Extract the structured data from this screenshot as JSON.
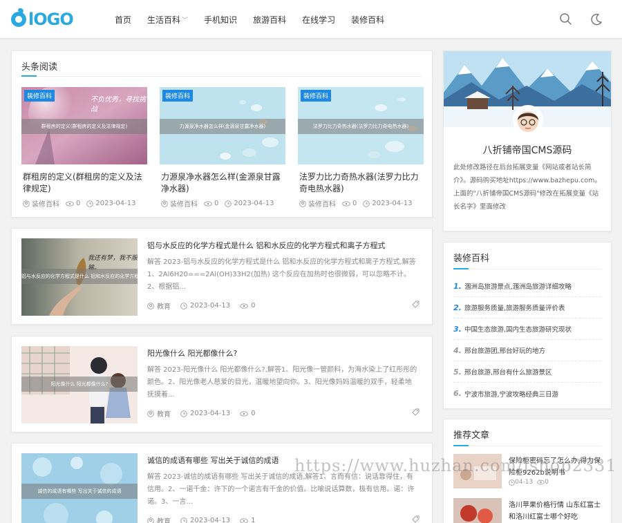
{
  "header": {
    "logo_text": "lOGO",
    "nav": [
      {
        "label": "首页"
      },
      {
        "label": "生活百科",
        "has_dropdown": true
      },
      {
        "label": "手机知识"
      },
      {
        "label": "旅游百科"
      },
      {
        "label": "在线学习"
      },
      {
        "label": "装修百科"
      }
    ]
  },
  "headline": {
    "title": "头条阅读",
    "items": [
      {
        "badge": "装修百科",
        "overlay": "群租房的定义(群租房的定义及法律规定)",
        "thumb_text": "不负优秀，寻找挑战",
        "title": "群租房的定义(群租房的定义及法律规定)",
        "author": "装修百科",
        "views": "0",
        "date": "2023-04-13"
      },
      {
        "badge": "装修百科",
        "overlay": "力源泉净水器怎么样(金源泉甘露净水器)",
        "title": "力源泉净水器怎么样(金源泉甘露净水器)",
        "author": "装修百科",
        "views": "0",
        "date": "2023-04-13"
      },
      {
        "badge": "装修百科",
        "overlay": "法罗力比力奇热水器(法罗力比力奇电热水器)",
        "title": "法罗力比力奇热水器(法罗力比力奇电热水器)",
        "author": "装修百科",
        "views": "0",
        "date": "2023-04-13"
      }
    ]
  },
  "articles": [
    {
      "overlay": "铝与水反应的化学方程式是什么 铝和水反应的化学方程式和离子",
      "thumb_text": "我还有梦，我不服输。",
      "title": "铝与水反应的化学方程式是什么 铝和水反应的化学方程式和离子方程式",
      "desc": "解答 2023-铝与水反应的化学方程式是什么 铝和水反应的化学方程式和离子方程式,解答1、2Al6H20===2Al(OH)33H2(加热) 这个反应在加热时也很微弱，可以忽略不计。2、根据铝...",
      "author": "教育",
      "date": "2023-04-13",
      "views": "0"
    },
    {
      "overlay": "阳光像什么 阳光都像什么?",
      "title": "阳光像什么 阳光都像什么?",
      "desc": "解答 2023-阳光像什么 阳光都像什么?,解答1、阳光像一管颜料，为海水染上了红彤彤的颜色。2、阳光像老人慈爱的目光，温暖地望向你。3、阳光像妈妈温暖的双手，轻柔地抚摸着...",
      "author": "教育",
      "date": "2023-04-13",
      "views": "0"
    },
    {
      "overlay": "诚信的成语有哪些 写出关于诚信的成语",
      "title": "诚信的成语有哪些 写出关于诚信的成语",
      "desc": "解答 2023-诚信的成语有哪些 写出关于诚信的成语,解答1、言而有信：说话靠得住，有信用。2、一诺千金：许下的一个诺言有千金的价值。比喻说话算数，极有信用。诺：许诺。3、一言...",
      "author": "教育",
      "date": "2023-04-13",
      "views": "1"
    }
  ],
  "profile": {
    "name": "八折铺帝国CMS源码",
    "desc": "此处修改路径在后台拓展变量《网站或者站长简介》。源码购买地址https://www.bazhepu.com。上面的\"八折铺帝国CMS源码\"修改在拓展变量《站长名字》里面修改"
  },
  "ranking": {
    "title": "装修百科",
    "items": [
      {
        "num": "1.",
        "text": "涠洲岛旅游景点,涠洲岛旅游详细攻略"
      },
      {
        "num": "2.",
        "text": "旅游服务质量,旅游服务质量评价表"
      },
      {
        "num": "3.",
        "text": "中国生态旅游,国内生态旅游研究现状"
      },
      {
        "num": "4.",
        "text": "邢台旅游团,邢台好玩的地方"
      },
      {
        "num": "5.",
        "text": "邢台旅游,邢台有什么旅游景区"
      },
      {
        "num": "6.",
        "text": "宁波市旅游,宁波攻略经典三日游"
      }
    ]
  },
  "recommend": {
    "title": "推荐文章",
    "items": [
      {
        "title": "保险柜密码忘了怎么办,得力保险柜9262b说明书",
        "date": "04-13",
        "views": "0"
      },
      {
        "title": "洛川苹果价格行情 山东红富士和洛川红富士哪个好吃",
        "date": "",
        "views": ""
      }
    ]
  },
  "watermark": "https://www.huzhan.com/ishop2331"
}
